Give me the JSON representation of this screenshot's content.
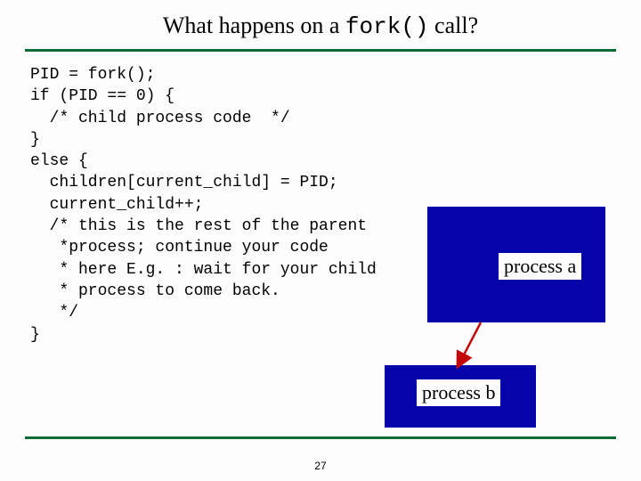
{
  "title": {
    "prefix": "What happens on a ",
    "mono": "fork()",
    "suffix": " call?"
  },
  "code": "PID = fork();\nif (PID == 0) {\n  /* child process code  */\n}\nelse {\n  children[current_child] = PID;\n  current_child++;\n  /* this is the rest of the parent\n   *process; continue your code\n   * here E.g. : wait for your child\n   * process to come back.\n   */\n}",
  "boxes": {
    "a": "process a",
    "b": "process b"
  },
  "page_number": "27"
}
